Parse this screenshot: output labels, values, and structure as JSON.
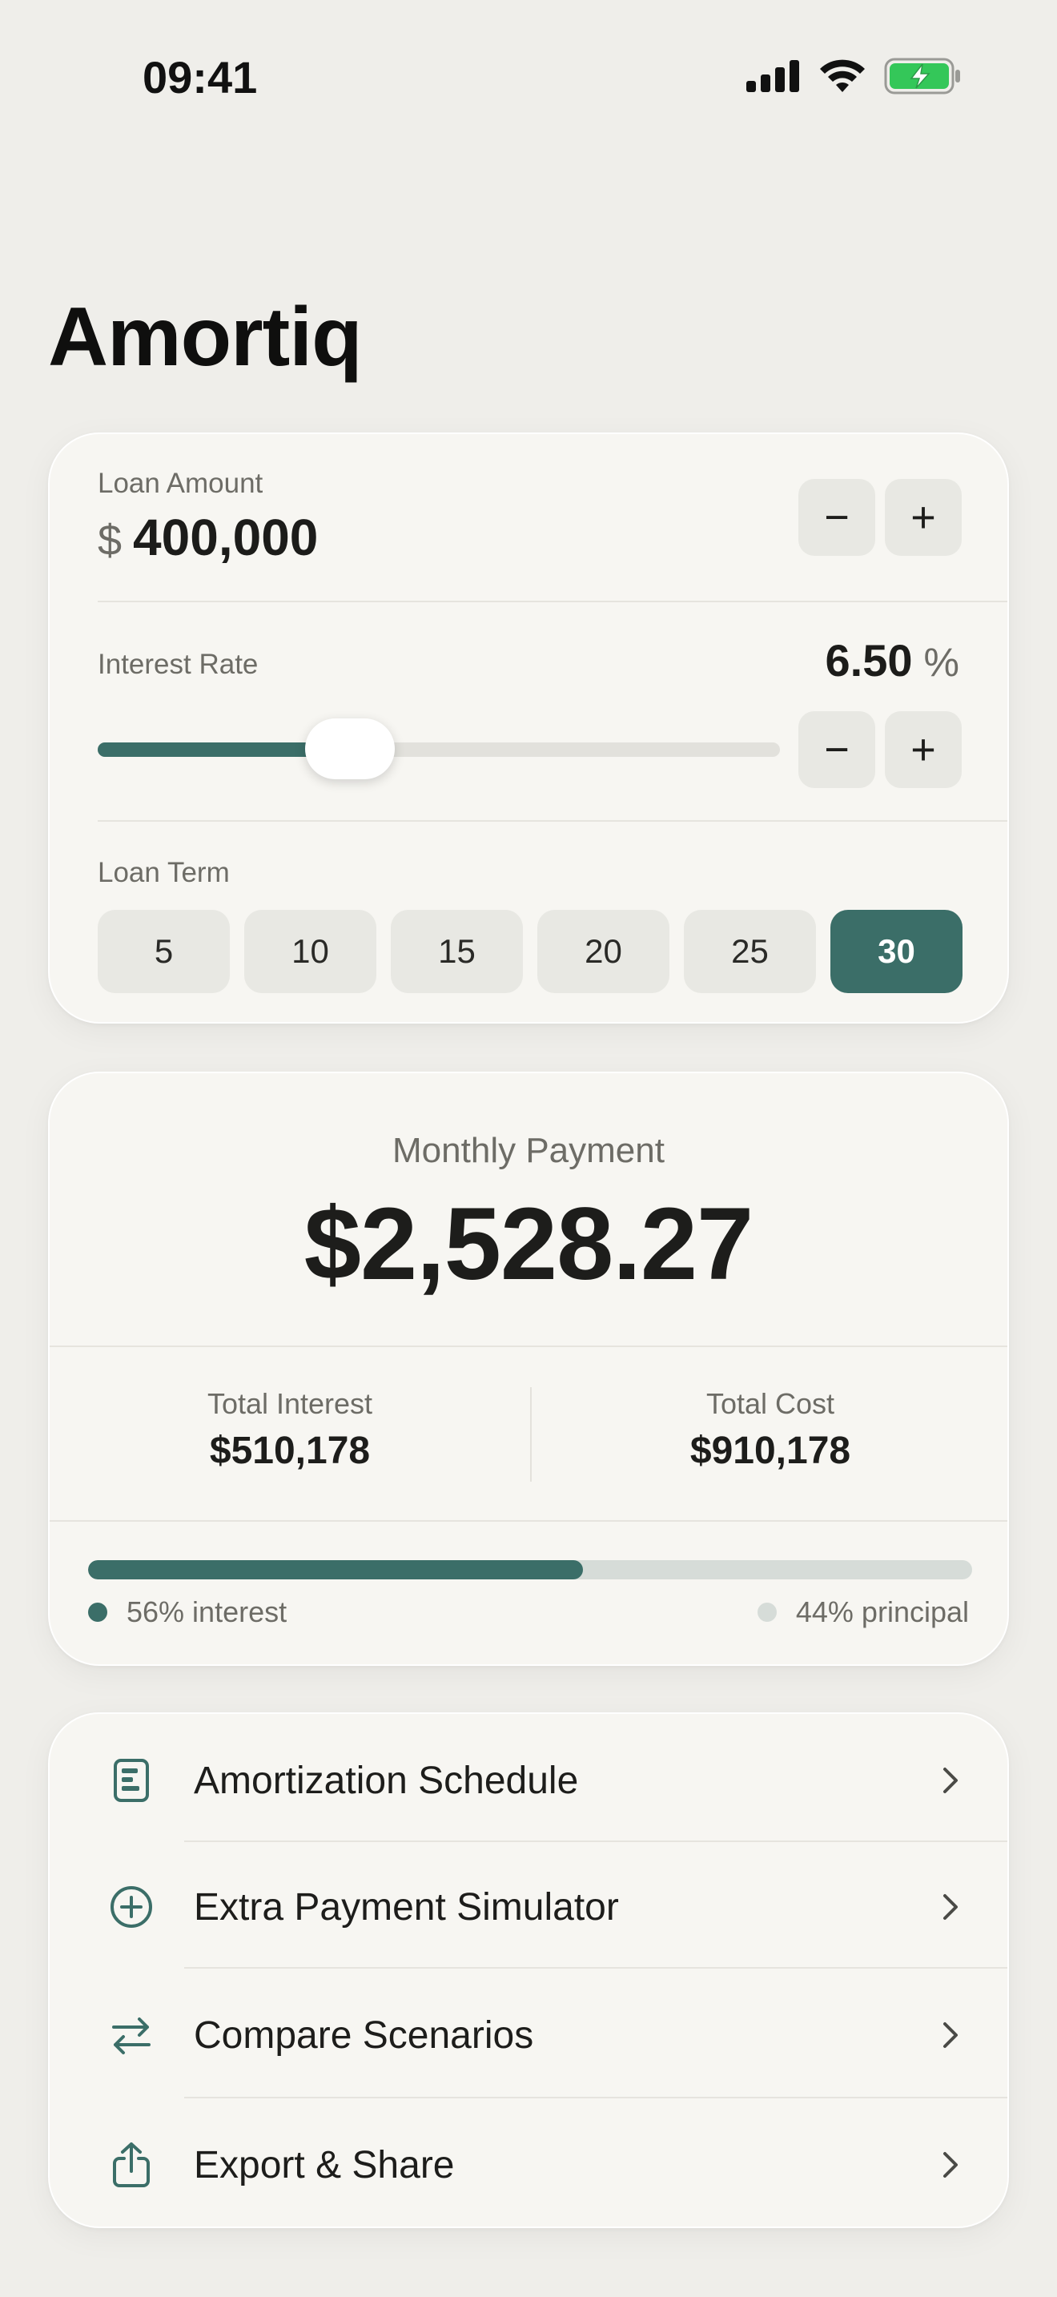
{
  "status_bar": {
    "time": "09:41"
  },
  "app": {
    "title": "Amortiq"
  },
  "loan_amount": {
    "label": "Loan Amount",
    "currency": "$",
    "value": "400,000",
    "decrement": "−",
    "increment": "+"
  },
  "interest_rate": {
    "label": "Interest Rate",
    "value": "6.50",
    "unit": "%",
    "slider_fraction": 0.37,
    "decrement": "−",
    "increment": "+"
  },
  "loan_term": {
    "label": "Loan Term",
    "options": [
      "5",
      "10",
      "15",
      "20",
      "25",
      "30"
    ],
    "selected": "30"
  },
  "payment": {
    "label": "Monthly Payment",
    "value": "$2,528.27",
    "total_interest_label": "Total Interest",
    "total_interest_value": "$510,178",
    "total_cost_label": "Total Cost",
    "total_cost_value": "$910,178",
    "interest_fraction": 0.56,
    "interest_legend": "56% interest",
    "principal_legend": "44% principal"
  },
  "menu": {
    "items": [
      {
        "label": "Amortization Schedule",
        "icon": "document-list-icon"
      },
      {
        "label": "Extra Payment Simulator",
        "icon": "plus-circle-icon"
      },
      {
        "label": "Compare Scenarios",
        "icon": "arrows-swap-icon"
      },
      {
        "label": "Export & Share",
        "icon": "share-icon"
      }
    ]
  },
  "colors": {
    "accent": "#3b6e68",
    "background": "#efeeea",
    "card": "#f7f6f2",
    "battery": "#34c759"
  }
}
